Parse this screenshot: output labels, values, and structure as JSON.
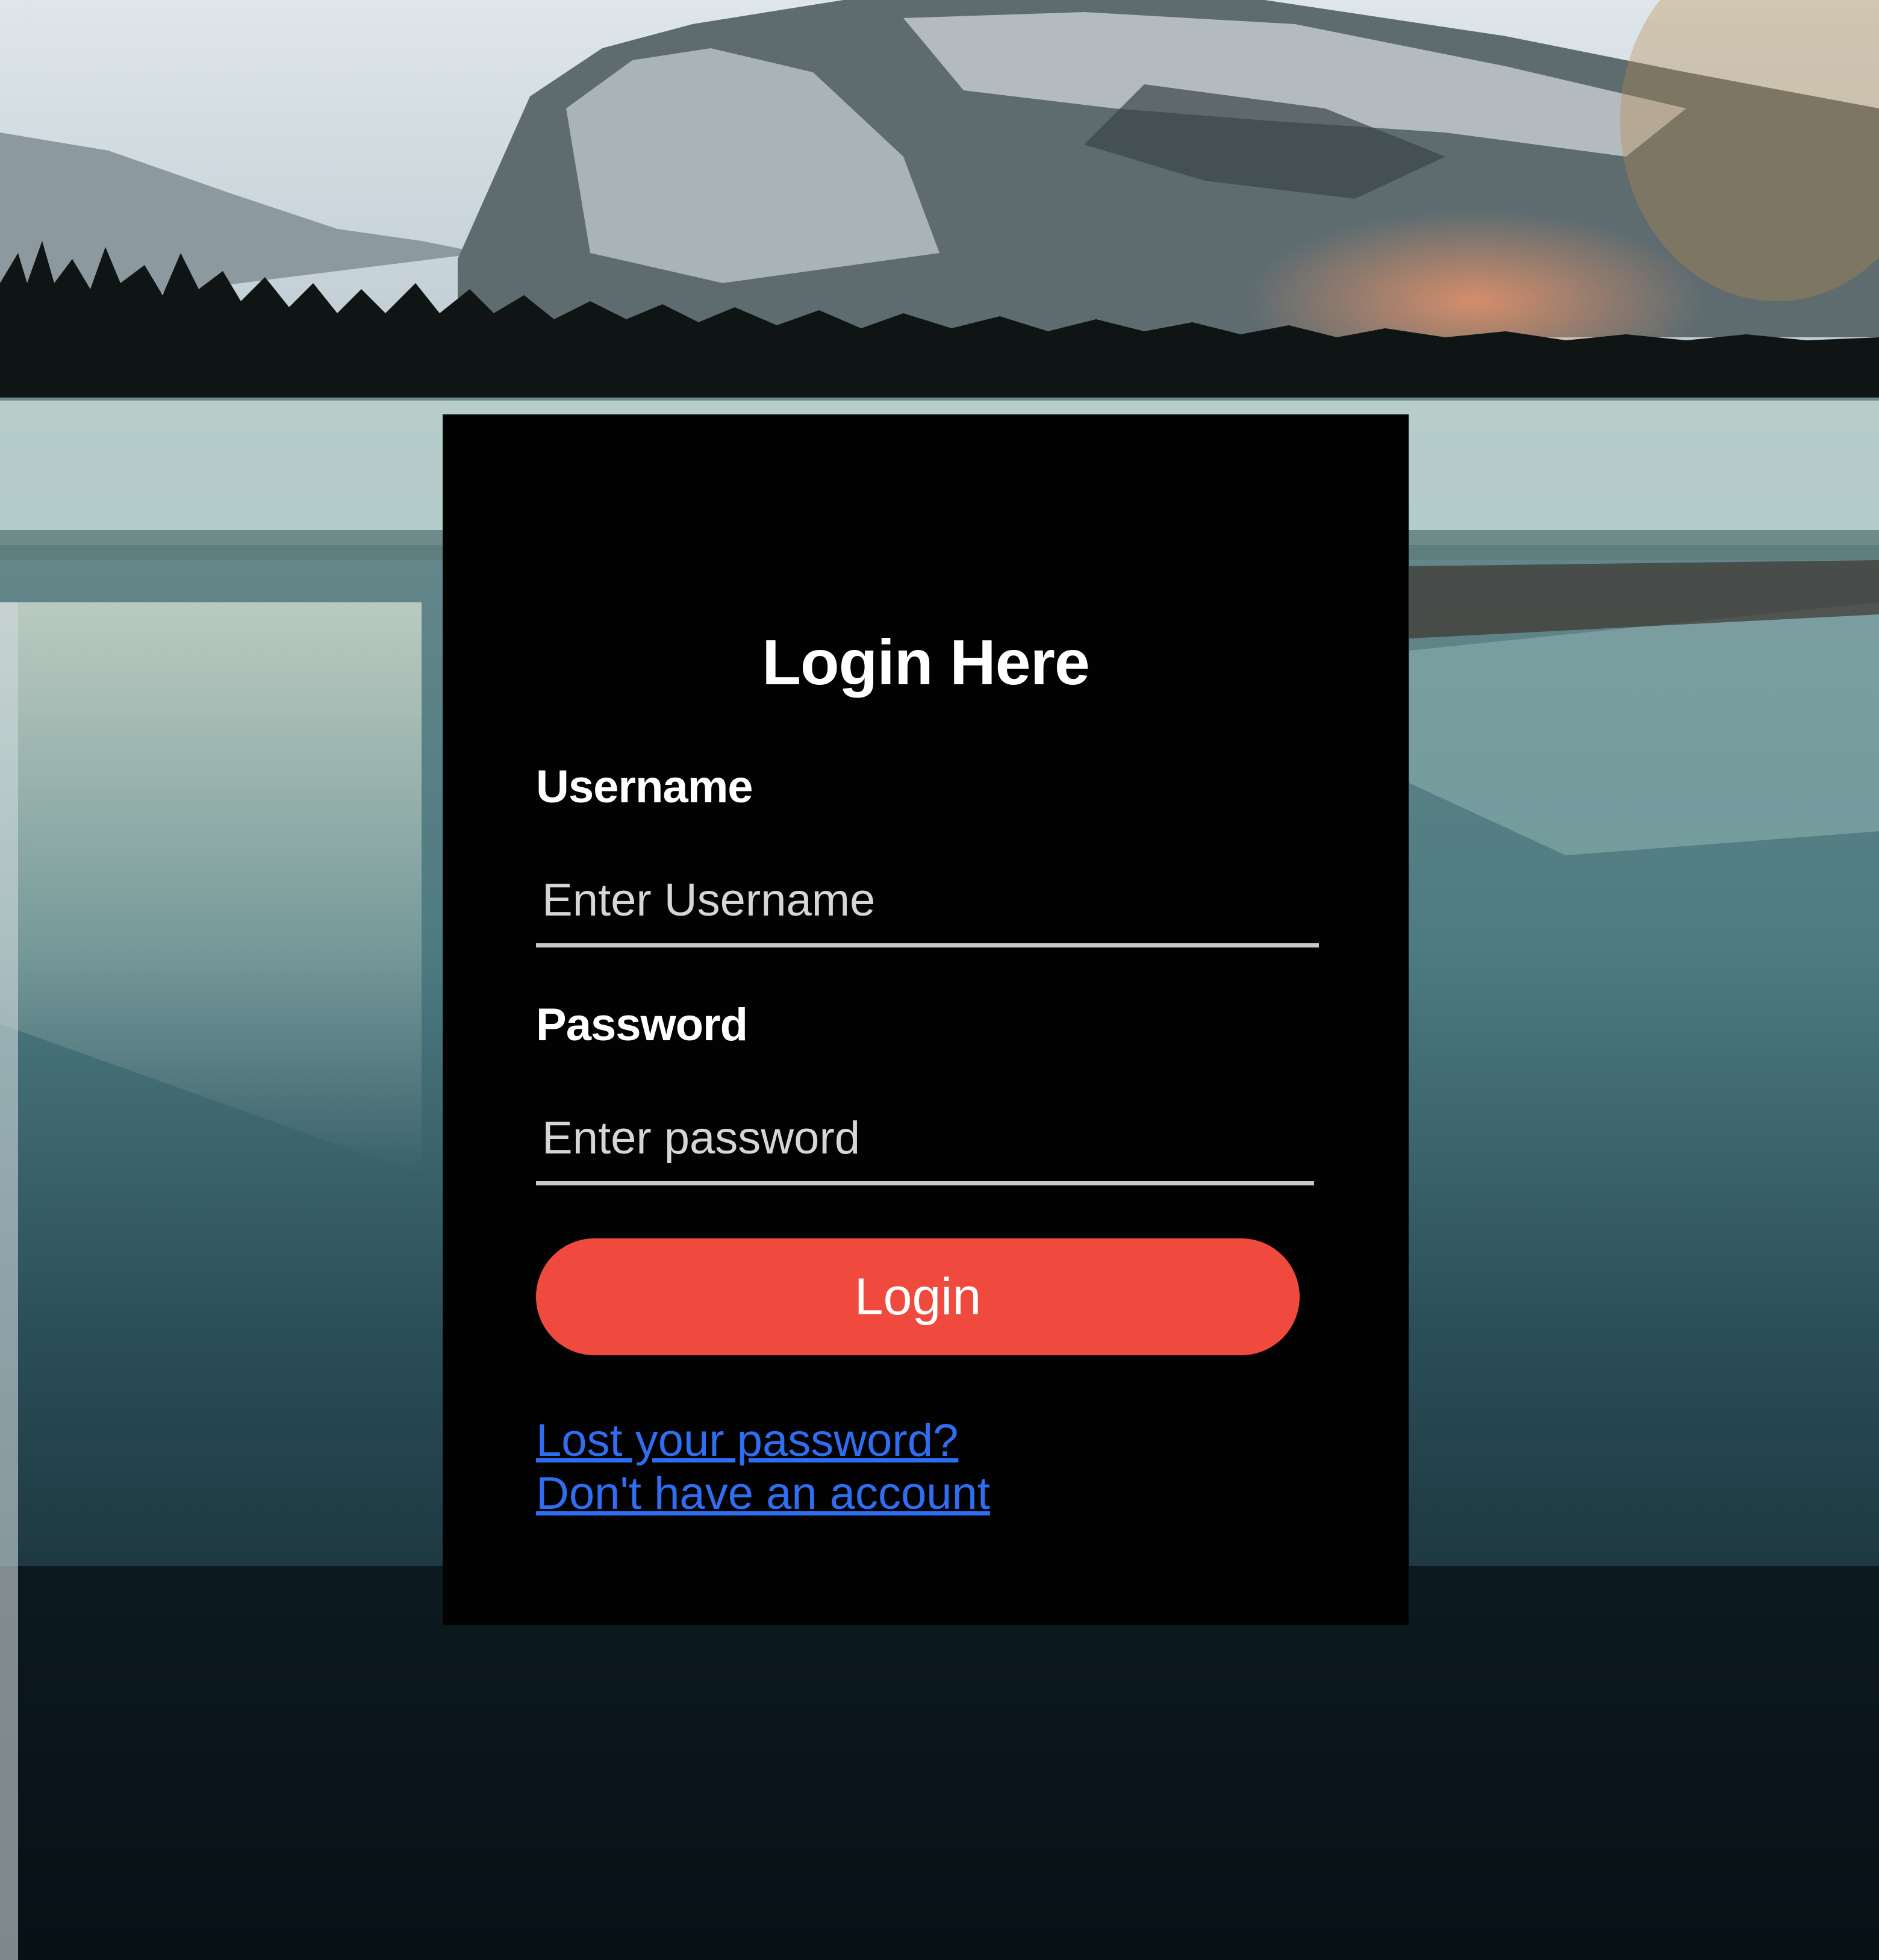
{
  "form": {
    "title": "Login Here",
    "username_label": "Username",
    "username_placeholder": "Enter Username",
    "password_label": "Password",
    "password_placeholder": "Enter password",
    "login_button": "Login",
    "lost_password_link": "Lost your password?",
    "signup_link": "Don't have an account"
  },
  "colors": {
    "panel": "#020202",
    "button": "#f04a3e",
    "link": "#2f6ef2",
    "text": "#ffffff"
  }
}
